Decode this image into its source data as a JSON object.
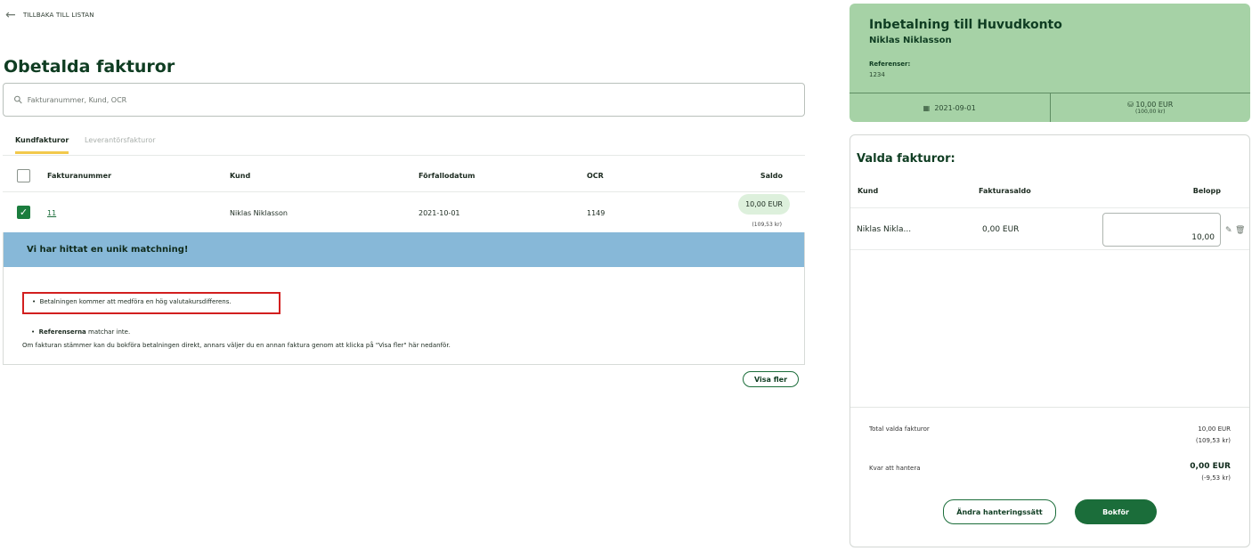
{
  "nav": {
    "back_label": "TILLBAKA TILL LISTAN"
  },
  "page": {
    "title": "Obetalda fakturor"
  },
  "search": {
    "placeholder": "Fakturanummer, Kund, OCR"
  },
  "tabs": [
    {
      "label": "Kundfakturor",
      "active": true
    },
    {
      "label": "Leverantörsfakturor",
      "active": false
    }
  ],
  "table": {
    "headers": [
      "Fakturanummer",
      "Kund",
      "Förfallodatum",
      "OCR",
      "Saldo"
    ],
    "rows": [
      {
        "invoice": "11",
        "customer": "Niklas Niklasson",
        "due": "2021-10-01",
        "ocr": "1149",
        "saldo": "10,00 EUR",
        "saldo_sek": "(109,53 kr)",
        "checked": true
      }
    ]
  },
  "match": {
    "heading": "Vi har hittat en unik matchning!",
    "bullet1": "Betalningen kommer att medföra en hög valutakursdifferens.",
    "bullet2_bold": "Referenserna",
    "bullet2_rest": " matchar inte.",
    "note": "Om fakturan stämmer kan du bokföra betalningen direkt, annars väljer du en annan faktura genom att klicka på \"Visa fler\" här nedanför."
  },
  "visa_fler": "Visa fler",
  "payment": {
    "title": "Inbetalning till Huvudkonto",
    "name": "Niklas Niklasson",
    "ref_label": "Referenser:",
    "ref_value": "1234",
    "date": "2021-09-01",
    "amount": "10,00 EUR",
    "amount_sek": "(100,00 kr)"
  },
  "selected": {
    "title": "Valda fakturor:",
    "headers": [
      "Kund",
      "Fakturasaldo",
      "Belopp"
    ],
    "row": {
      "customer": "Niklas Nikla...",
      "saldo": "0,00 EUR",
      "amount": "10,00"
    },
    "total_label": "Total valda fakturor",
    "total_value": "10,00 EUR",
    "total_sek": "(109,53 kr)",
    "remain_label": "Kvar att hantera",
    "remain_value": "0,00 EUR",
    "remain_sek": "(-9,53 kr)",
    "change_label": "Ändra hanteringssätt",
    "book_label": "Bokför"
  },
  "colors": {
    "accent": "#1b6d3a",
    "match_header": "#87b8d8",
    "payment_card": "#a6d2a6",
    "tab_underline": "#f2c94c",
    "warning_border": "#d21f1f"
  }
}
